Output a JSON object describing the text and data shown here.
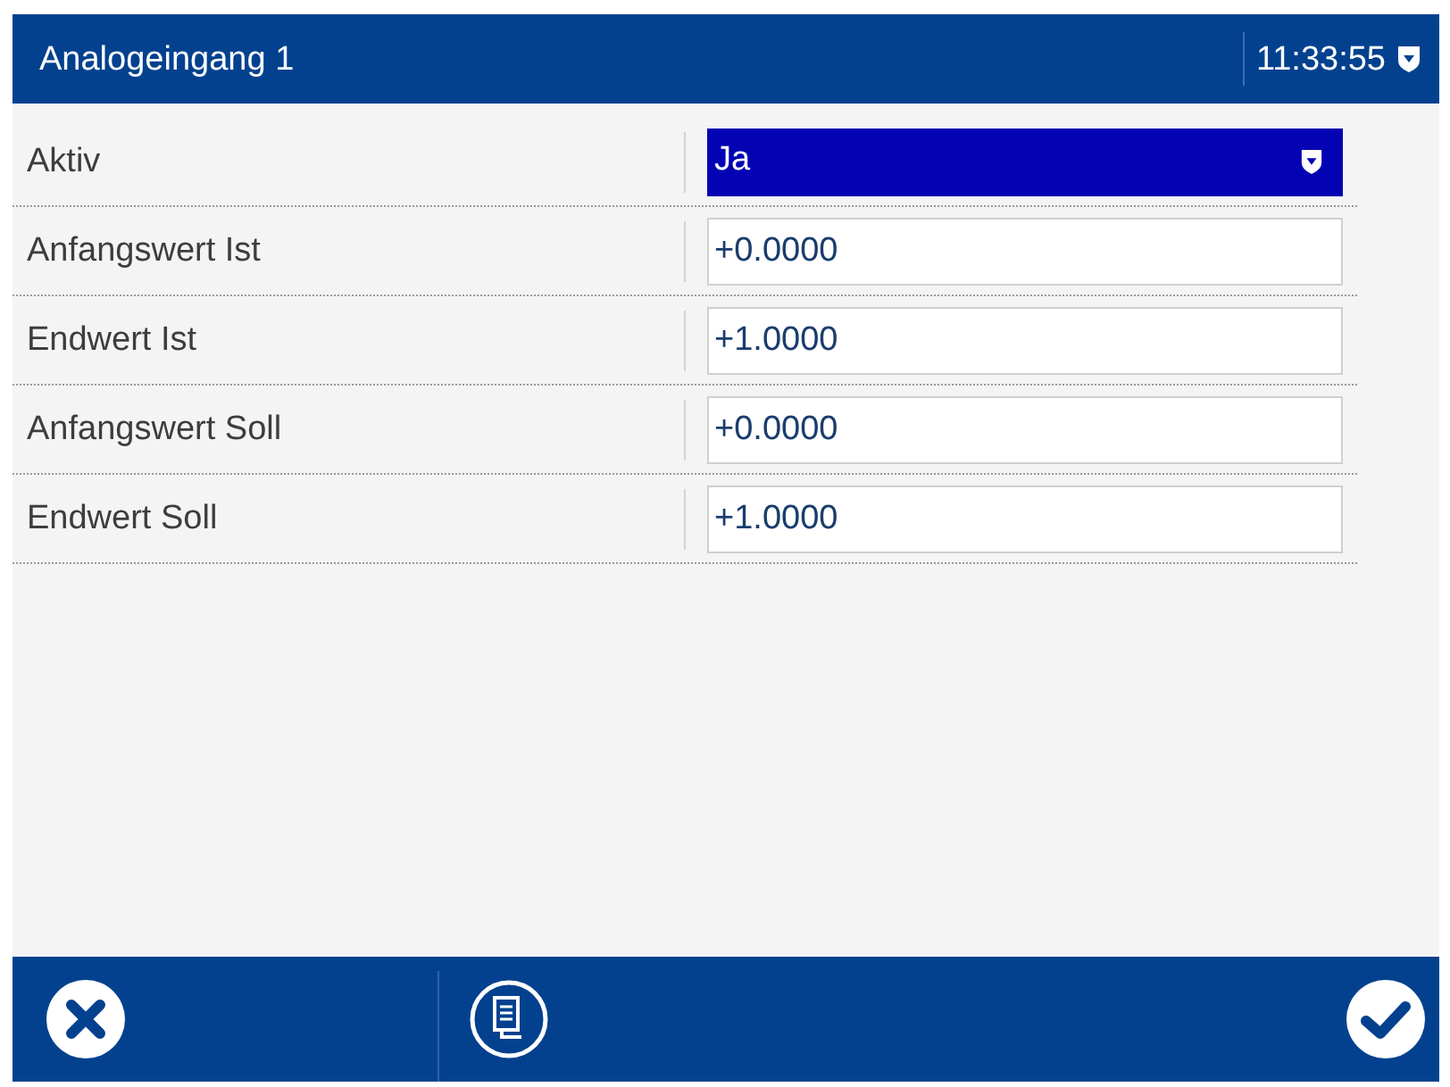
{
  "window": {
    "title": "Analogeingang 1",
    "time": "11:33:55"
  },
  "fields": [
    {
      "label": "Aktiv",
      "kind": "dropdown",
      "value": "Ja",
      "selected": true
    },
    {
      "label": "Anfangswert Ist",
      "kind": "number",
      "value": "+0.0000",
      "selected": false
    },
    {
      "label": "Endwert Ist",
      "kind": "number",
      "value": "+1.0000",
      "selected": false
    },
    {
      "label": "Anfangswert Soll",
      "kind": "number",
      "value": "+0.0000",
      "selected": false
    },
    {
      "label": "Endwert Soll",
      "kind": "number",
      "value": "+1.0000",
      "selected": false
    }
  ],
  "toolbar": [
    {
      "kind": "cancel"
    },
    {
      "kind": "copy"
    },
    {
      "kind": "confirm"
    }
  ]
}
